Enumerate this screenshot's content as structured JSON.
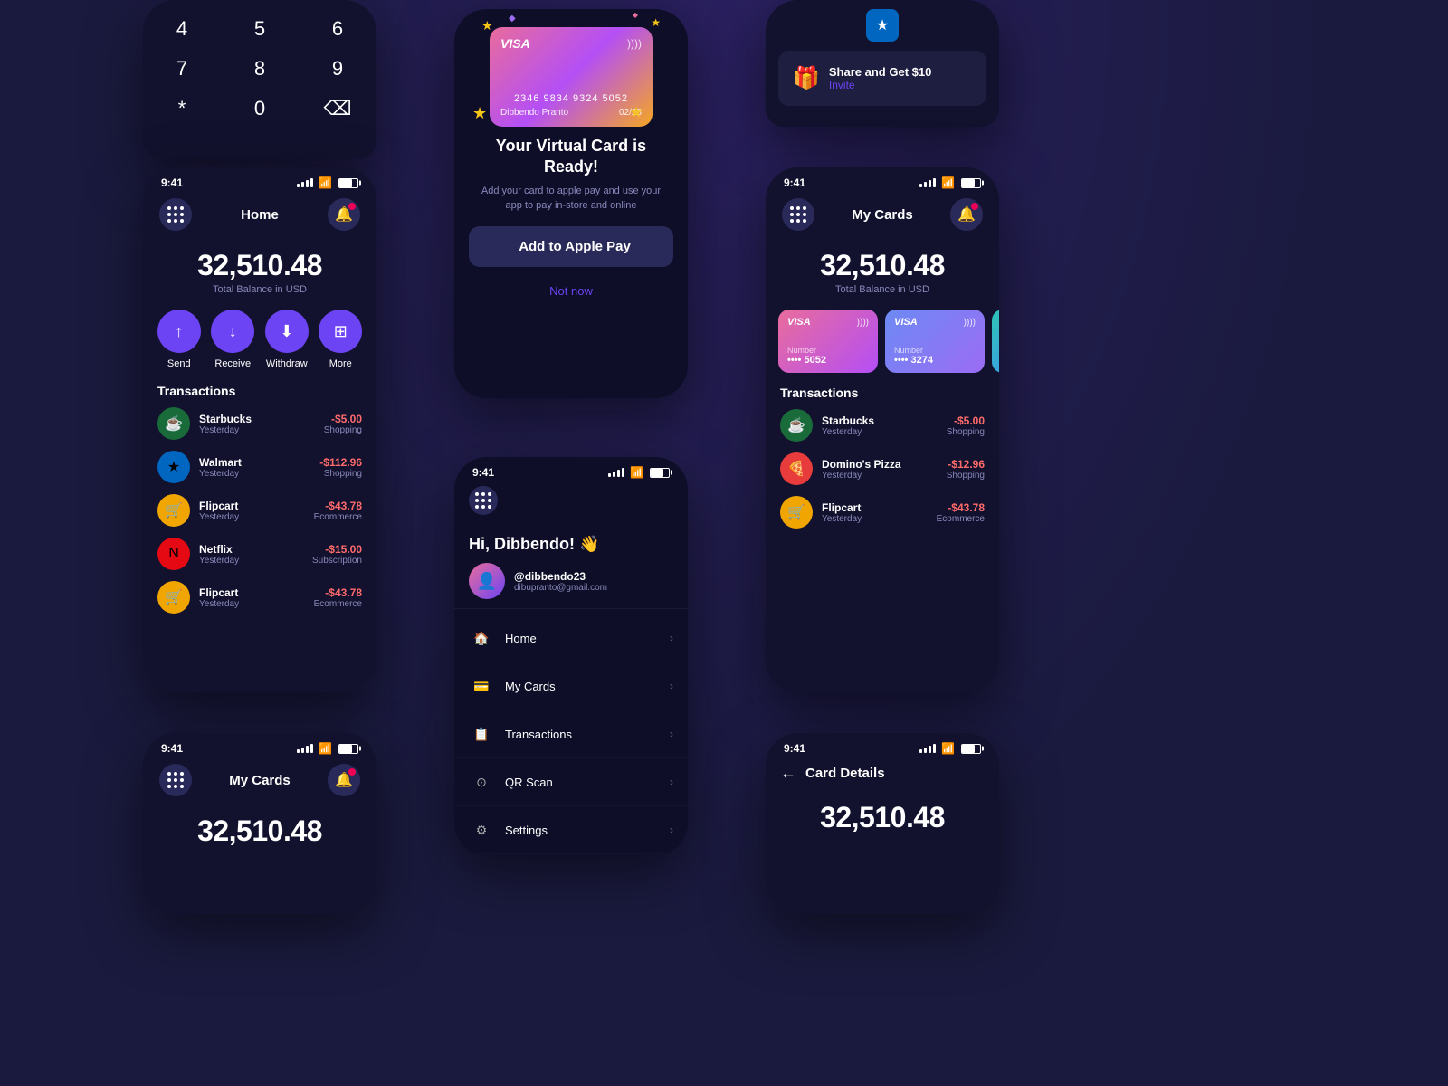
{
  "bg_color": "#1a1a3e",
  "phone1": {
    "time": "9:41",
    "title": "Home",
    "balance": "32,510.48",
    "balance_label": "Total Balance in USD",
    "actions": [
      {
        "label": "Send",
        "icon": "↑"
      },
      {
        "label": "Receive",
        "icon": "↓"
      },
      {
        "label": "Withdraw",
        "icon": "⬇"
      },
      {
        "label": "More",
        "icon": "⊞"
      }
    ],
    "section_title": "Transactions",
    "transactions": [
      {
        "name": "Starbucks",
        "date": "Yesterday",
        "amount": "-$5.00",
        "category": "Shopping",
        "icon": "☕",
        "bg": "#1a6b3a"
      },
      {
        "name": "Walmart",
        "date": "Yesterday",
        "amount": "-$112.96",
        "category": "Shopping",
        "icon": "★",
        "bg": "#0066c0"
      },
      {
        "name": "Flipcart",
        "date": "Yesterday",
        "amount": "-$43.78",
        "category": "Ecommerce",
        "icon": "🛒",
        "bg": "#f0a500"
      },
      {
        "name": "Netflix",
        "date": "Yesterday",
        "amount": "-$15.00",
        "category": "Subscription",
        "icon": "N",
        "bg": "#e50914"
      },
      {
        "name": "Flipcart",
        "date": "Yesterday",
        "amount": "-$43.78",
        "category": "Ecommerce",
        "icon": "🛒",
        "bg": "#f0a500"
      }
    ]
  },
  "phone2": {
    "card_number": "2346 9834 9324 5052",
    "card_name": "Dibbendo Pranto",
    "card_expiry": "02/28",
    "title": "Your Virtual Card is Ready!",
    "subtitle": "Add your card to apple pay and use your app to pay in-store and online",
    "apple_pay_label": "Add to Apple Pay",
    "not_now_label": "Not now"
  },
  "phone3": {
    "time": "9:41",
    "title": "My Cards",
    "balance": "32,510.48",
    "balance_label": "Total Balance in USD",
    "cards": [
      {
        "type": "VISA",
        "number_label": "Number",
        "last4": "5052",
        "style": "pink"
      },
      {
        "type": "VISA",
        "number_label": "Number",
        "last4": "3274",
        "style": "blue"
      }
    ],
    "section_title": "Transactions",
    "transactions": [
      {
        "name": "Starbucks",
        "date": "Yesterday",
        "amount": "-$5.00",
        "category": "Shopping",
        "icon": "☕",
        "bg": "#1a6b3a"
      },
      {
        "name": "Domino's Pizza",
        "date": "Yesterday",
        "amount": "-$12.96",
        "category": "Shopping",
        "icon": "🍕",
        "bg": "#e83c3c"
      },
      {
        "name": "Flipcart",
        "date": "Yesterday",
        "amount": "-$43.78",
        "category": "Ecommerce",
        "icon": "🛒",
        "bg": "#f0a500"
      }
    ]
  },
  "phone4": {
    "time": "9:41",
    "greeting": "Hi, Dibbendo! 👋",
    "username": "@dibbendo23",
    "email": "dibupranto@gmail.com",
    "menu_items": [
      {
        "label": "Home",
        "icon": "🏠"
      },
      {
        "label": "My Cards",
        "icon": "💳"
      },
      {
        "label": "Transactions",
        "icon": "📋"
      },
      {
        "label": "QR Scan",
        "icon": "⊙"
      },
      {
        "label": "Settings",
        "icon": "⚙"
      }
    ]
  },
  "phone5": {
    "time": "9:41",
    "title": "My Cards",
    "balance": "32,510.48"
  },
  "phone6": {
    "time": "9:41",
    "title": "Card Details",
    "balance": "32,510.48"
  },
  "phone_numpad": {
    "keys": [
      "4",
      "5",
      "6",
      "7",
      "8",
      "9",
      "*",
      "0",
      "⌫"
    ]
  },
  "phone_topright": {
    "share_title": "Share and Get $10",
    "share_link": "Invite",
    "walmart_icon": "★"
  }
}
